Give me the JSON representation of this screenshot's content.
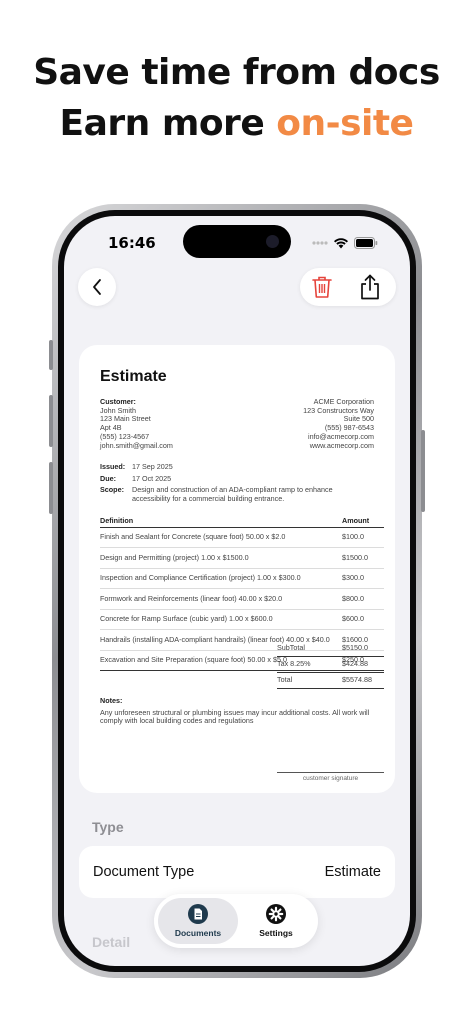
{
  "promo": {
    "line1": "Save time from docs",
    "line2_prefix": "Earn more ",
    "line2_accent": "on-site",
    "accent_color": "#f28a45"
  },
  "status_bar": {
    "time": "16:46",
    "icons": [
      "signal-dots-icon",
      "wifi-icon",
      "battery-icon"
    ]
  },
  "toolbar": {
    "back_icon": "chevron-left-icon",
    "delete_icon": "trash-icon",
    "share_icon": "share-icon",
    "delete_color": "#e5433b"
  },
  "document": {
    "title": "Estimate",
    "customer_label": "Customer:",
    "customer": {
      "name": "John Smith",
      "street": "123 Main Street",
      "apt": "Apt 4B",
      "phone": "(555) 123-4567",
      "email": "john.smith@gmail.com"
    },
    "company": {
      "name": "ACME Corporation",
      "street": "123 Constructors Way",
      "suite": "Suite 500",
      "phone": "(555) 987-6543",
      "email": "info@acmecorp.com",
      "website": "www.acmecorp.com"
    },
    "issued_label": "Issued:",
    "issued": "17 Sep 2025",
    "due_label": "Due:",
    "due": "17 Oct 2025",
    "scope_label": "Scope:",
    "scope": "Design and construction of an ADA-compliant ramp to enhance accessibility for a commercial building entrance.",
    "columns": {
      "definition": "Definition",
      "amount": "Amount"
    },
    "items": [
      {
        "definition": "Finish and Sealant for Concrete (square foot) 50.00 x $2.0",
        "amount": "$100.0"
      },
      {
        "definition": "Design and Permitting (project) 1.00 x $1500.0",
        "amount": "$1500.0"
      },
      {
        "definition": "Inspection and Compliance Certification (project) 1.00 x $300.0",
        "amount": "$300.0"
      },
      {
        "definition": "Formwork and Reinforcements (linear foot) 40.00 x $20.0",
        "amount": "$800.0"
      },
      {
        "definition": "Concrete for Ramp Surface (cubic yard) 1.00 x $600.0",
        "amount": "$600.0"
      },
      {
        "definition": "Handrails (installing ADA-compliant handrails) (linear foot) 40.00 x $40.0",
        "amount": "$1600.0"
      },
      {
        "definition": "Excavation and Site Preparation (square foot) 50.00 x $5.0",
        "amount": "$250.0"
      }
    ],
    "totals": [
      {
        "label": "SubTotal",
        "value": "$5150.0"
      },
      {
        "label": "Tax 8.25%",
        "value": "$424.88"
      },
      {
        "label": "Total",
        "value": "$5574.88"
      }
    ],
    "notes_label": "Notes:",
    "notes": "Any unforeseen structural or plumbing issues may incur additional costs. All work will comply with local building codes and regulations",
    "signature_label": "customer signature"
  },
  "sections": {
    "type_header": "Type",
    "document_type_label": "Document Type",
    "document_type_value": "Estimate",
    "detail_header": "Detail"
  },
  "tabbar": {
    "tabs": [
      {
        "label": "Documents",
        "icon": "document-icon",
        "active": true
      },
      {
        "label": "Settings",
        "icon": "gear-icon",
        "active": false
      }
    ]
  }
}
